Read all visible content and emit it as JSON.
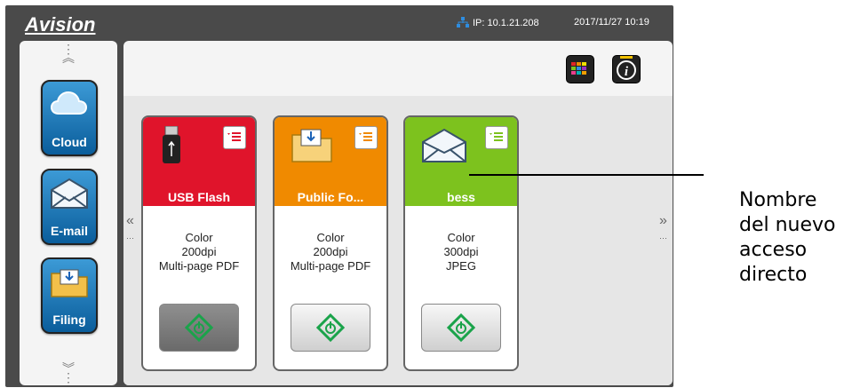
{
  "header": {
    "logo": "Avision",
    "ip": "IP: 10.1.21.208",
    "datetime": "2017/11/27 10:19"
  },
  "sidebar": {
    "items": [
      {
        "label": "Cloud",
        "icon": "cloud-icon"
      },
      {
        "label": "E-mail",
        "icon": "envelope-icon"
      },
      {
        "label": "Filing",
        "icon": "folder-icon"
      }
    ]
  },
  "toolbar": {
    "palette": "color-palette-icon",
    "info": "info-icon"
  },
  "nav": {
    "left": "«",
    "right": "»"
  },
  "shortcuts": [
    {
      "title": "USB Flash",
      "color": "Color",
      "dpi": "200dpi",
      "format": "Multi-page PDF",
      "head_color": "#e0142b"
    },
    {
      "title": "Public Fo...",
      "color": "Color",
      "dpi": "200dpi",
      "format": "Multi-page PDF",
      "head_color": "#f08a00"
    },
    {
      "title": "bess",
      "color": "Color",
      "dpi": "300dpi",
      "format": "JPEG",
      "head_color": "#7dc21e"
    }
  ],
  "annotation": {
    "line1": "Nombre",
    "line2": "del nuevo",
    "line3": "acceso",
    "line4": "directo"
  }
}
